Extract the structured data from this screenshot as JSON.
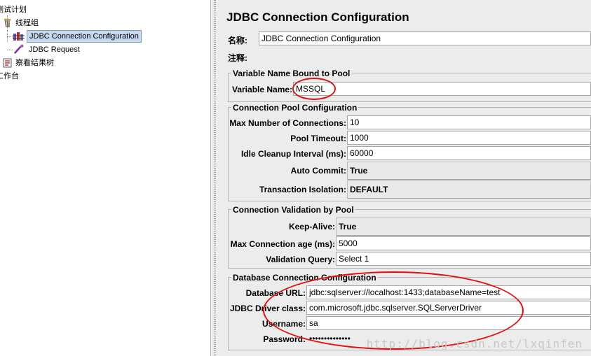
{
  "tree": {
    "items": [
      {
        "label": "测试计划",
        "icon": "test-plan-icon"
      },
      {
        "label": "线程组",
        "icon": "thread-group-icon"
      },
      {
        "label": "JDBC Connection Configuration",
        "icon": "jdbc-config-icon",
        "selected": true
      },
      {
        "label": "JDBC Request",
        "icon": "jdbc-request-icon"
      },
      {
        "label": "察看结果树",
        "icon": "results-tree-icon"
      },
      {
        "label": "工作台",
        "icon": "workbench-icon"
      }
    ]
  },
  "panel": {
    "title": "JDBC Connection Configuration",
    "name_label": "名称:",
    "name_value": "JDBC Connection Configuration",
    "comment_label": "注释:",
    "comment_value": "",
    "groups": {
      "variable": {
        "title": "Variable Name Bound to Pool",
        "variable_name_label": "Variable Name:",
        "variable_name_value": "MSSQL"
      },
      "pool": {
        "title": "Connection Pool Configuration",
        "max_connections_label": "Max Number of Connections:",
        "max_connections_value": "10",
        "pool_timeout_label": "Pool Timeout:",
        "pool_timeout_value": "1000",
        "idle_cleanup_label": "Idle Cleanup Interval (ms):",
        "idle_cleanup_value": "60000",
        "auto_commit_label": "Auto Commit:",
        "auto_commit_value": "True",
        "transaction_isolation_label": "Transaction Isolation:",
        "transaction_isolation_value": "DEFAULT"
      },
      "validation": {
        "title": "Connection Validation by Pool",
        "keep_alive_label": "Keep-Alive:",
        "keep_alive_value": "True",
        "max_age_label": "Max Connection age (ms):",
        "max_age_value": "5000",
        "validation_query_label": "Validation Query:",
        "validation_query_value": "Select 1"
      },
      "database": {
        "title": "Database Connection Configuration",
        "url_label": "Database URL:",
        "url_value": "jdbc:sqlserver://localhost:1433;databaseName=test",
        "driver_label": "JDBC Driver class:",
        "driver_value": "com.microsoft.jdbc.sqlserver.SQLServerDriver",
        "username_label": "Username:",
        "username_value": "sa",
        "password_label": "Password:",
        "password_value": "••••••••••••••"
      }
    }
  },
  "watermark": "http://blog.csdn.net/lxqinfen",
  "colors": {
    "panel_bg": "#ececec",
    "selection_bg": "#c6d8ee",
    "annotation_red": "#e01010"
  }
}
